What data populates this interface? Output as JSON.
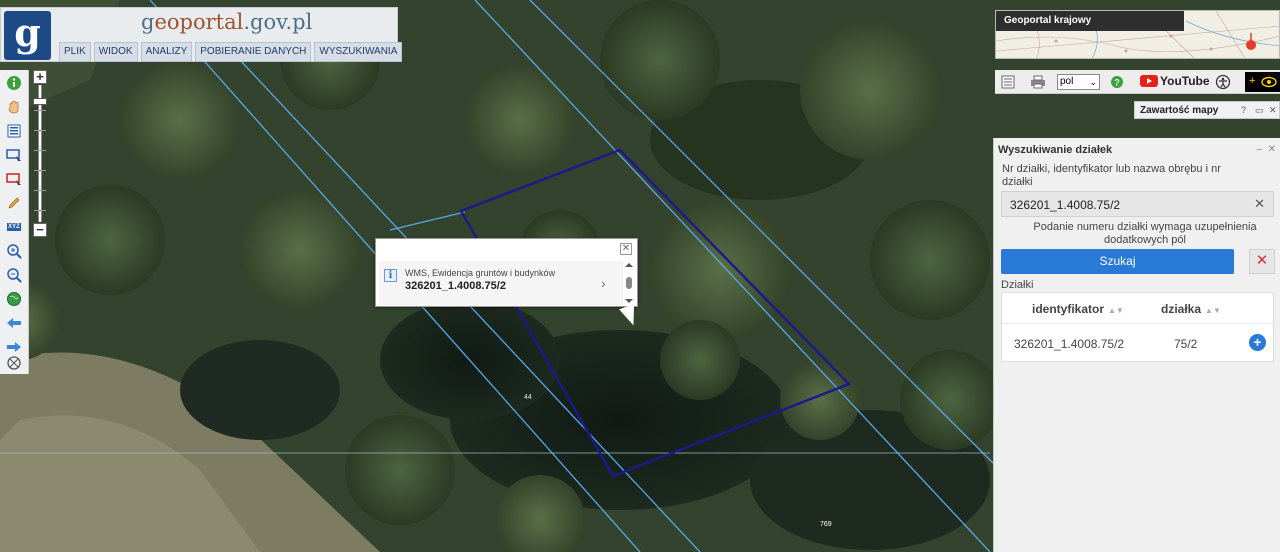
{
  "header": {
    "title_prefix": "g",
    "title_accent": "eoportal",
    "title_suffix": ".gov.pl",
    "logo_letter": "g",
    "menu": [
      "PLIK",
      "WIDOK",
      "ANALIZY",
      "POBIERANIE DANYCH",
      "WYSZUKIWANIA"
    ]
  },
  "left_toolbar": {
    "icons": [
      "info-icon",
      "pan-hand-icon",
      "layers-list-icon",
      "select-rect-icon",
      "clear-select-icon",
      "pencil-icon",
      "xyz-icon",
      "zoom-in-icon",
      "zoom-out-icon",
      "globe-icon",
      "back-arrow-icon",
      "forward-arrow-icon",
      "locate-icon"
    ],
    "xyz_label": "XYZ"
  },
  "zoom": {
    "plus": "+",
    "minus": "−"
  },
  "map": {
    "labels": [
      "44",
      "769"
    ]
  },
  "popup": {
    "info_glyph": "i",
    "layer_name": "WMS, Ewidencja gruntów i budynków",
    "parcel_id": "326201_1.4008.75/2",
    "close": "✕",
    "arrow": "›"
  },
  "mini_map": {
    "title": "Geoportal krajowy"
  },
  "right_bar": {
    "language": "pol",
    "youtube_label": "YouTube"
  },
  "map_content": {
    "title": "Zawartość mapy",
    "help": "?"
  },
  "search": {
    "title": "Wyszukiwanie działek",
    "description": "Nr działki, identyfikator lub nazwa obrębu i nr działki",
    "input_value": "326201_1.4008.75/2",
    "hint": "Podanie numeru działki wymaga uzupełnienia dodatkowych pól",
    "search_button": "Szukaj",
    "cancel_button": "✕",
    "results_label": "Działki",
    "columns": [
      "identyfikator",
      "działka"
    ],
    "rows": [
      {
        "identyfikator": "326201_1.4008.75/2",
        "dzialka": "75/2"
      }
    ],
    "add_button": "+"
  },
  "colors": {
    "parcel_outline": "#1a1a8c",
    "parcel_boundaries": "#5aa8e6",
    "accent_blue": "#2979d6"
  }
}
